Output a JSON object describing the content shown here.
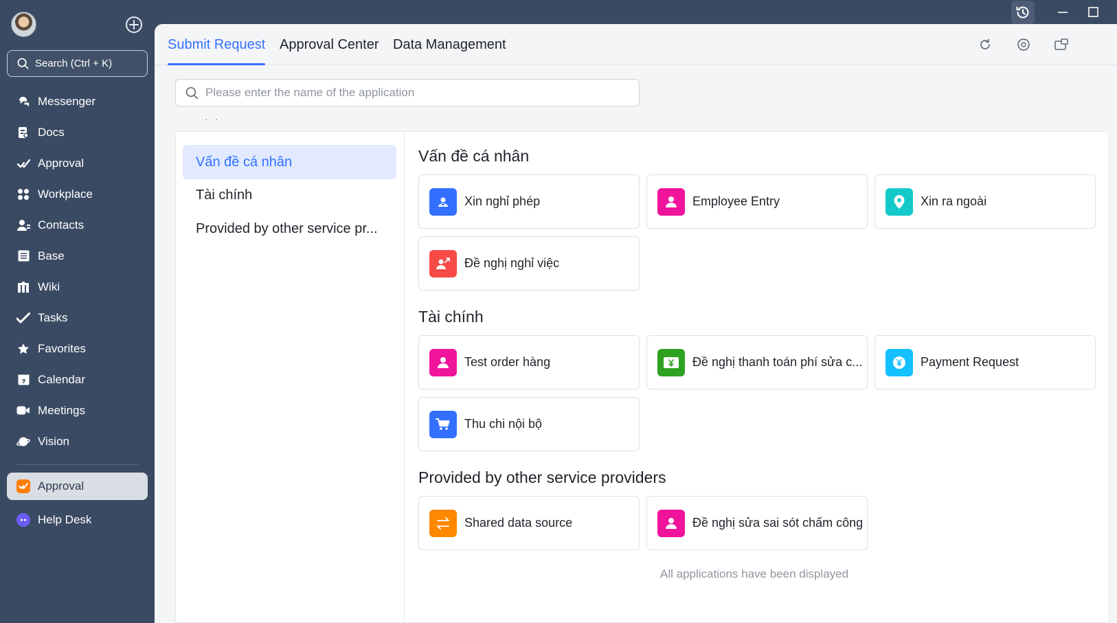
{
  "sidebar": {
    "search_label": "Search (Ctrl + K)",
    "nav": [
      {
        "label": "Messenger",
        "icon": "messenger-icon"
      },
      {
        "label": "Docs",
        "icon": "docs-icon"
      },
      {
        "label": "Approval",
        "icon": "approval-check-icon"
      },
      {
        "label": "Workplace",
        "icon": "workplace-grid-icon"
      },
      {
        "label": "Contacts",
        "icon": "contacts-icon"
      },
      {
        "label": "Base",
        "icon": "base-table-icon"
      },
      {
        "label": "Wiki",
        "icon": "wiki-icon"
      },
      {
        "label": "Tasks",
        "icon": "tasks-check-icon"
      },
      {
        "label": "Favorites",
        "icon": "star-icon"
      },
      {
        "label": "Calendar",
        "icon": "calendar-icon"
      },
      {
        "label": "Meetings",
        "icon": "video-camera-icon"
      },
      {
        "label": "Vision",
        "icon": "planet-icon"
      }
    ],
    "apps": [
      {
        "label": "Approval",
        "icon": "approval-app-icon",
        "color": "#ff7d00"
      },
      {
        "label": "Help Desk",
        "icon": "help-desk-icon",
        "color": "#6b5cf5"
      }
    ]
  },
  "tabs": {
    "submit": "Submit Request",
    "approval_center": "Approval Center",
    "data_management": "Data Management"
  },
  "search": {
    "placeholder": "Please enter the name of the application",
    "value": ""
  },
  "dots": "· ·",
  "categories": [
    {
      "label": "Vấn đề cá nhân"
    },
    {
      "label": "Tài chính"
    },
    {
      "label": "Provided by other service pr..."
    }
  ],
  "sections": {
    "personal": {
      "title": "Vấn đề cá nhân",
      "apps": [
        {
          "label": "Xin nghỉ phép",
          "color": "#3370ff",
          "icon": "person-badge-icon"
        },
        {
          "label": "Employee Entry",
          "color": "#f0139b",
          "icon": "person-icon"
        },
        {
          "label": "Xin ra ngoài",
          "color": "#14c9c9",
          "icon": "location-pin-icon"
        },
        {
          "label": "Đề nghị nghỉ việc",
          "color": "#f54a45",
          "icon": "person-leave-icon"
        }
      ]
    },
    "finance": {
      "title": "Tài chính",
      "apps": [
        {
          "label": "Test order hàng",
          "color": "#f0139b",
          "icon": "person-icon"
        },
        {
          "label": "Đề nghị thanh toán phí sửa c...",
          "color": "#2ea121",
          "icon": "yen-bill-icon"
        },
        {
          "label": "Payment Request",
          "color": "#14c0ff",
          "icon": "yen-coin-icon"
        },
        {
          "label": "Thu chi nội bộ",
          "color": "#3370ff",
          "icon": "shopping-cart-icon"
        }
      ]
    },
    "providers": {
      "title": "Provided by other service providers",
      "apps": [
        {
          "label": "Shared data source",
          "color": "#ff8800",
          "icon": "exchange-arrows-icon"
        },
        {
          "label": "Đề nghị sửa sai sót chấm công",
          "color": "#f0139b",
          "icon": "person-icon"
        }
      ]
    }
  },
  "footer_note": "All applications have been displayed"
}
